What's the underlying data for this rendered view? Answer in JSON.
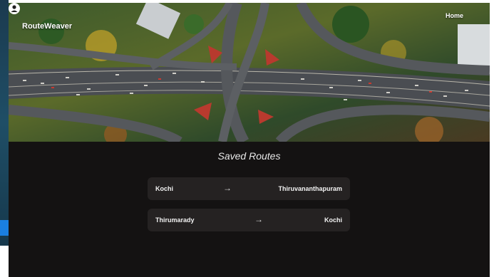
{
  "brand": {
    "name": "RouteWeaver"
  },
  "nav": {
    "home_label": "Home",
    "user_icon": "user-icon"
  },
  "page": {
    "title": "Saved Routes"
  },
  "routes": [
    {
      "from": "Kochi",
      "to": "Thiruvananthapuram",
      "arrow": "→"
    },
    {
      "from": "Thirumarady",
      "to": "Kochi",
      "arrow": "→"
    }
  ],
  "colors": {
    "background": "#141212",
    "card": "#252222",
    "text": "#f2f2f2",
    "desktop_accent": "#1a7fe0"
  }
}
